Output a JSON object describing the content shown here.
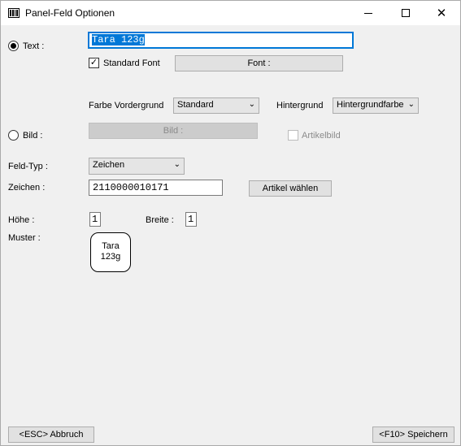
{
  "window": {
    "title": "Panel-Feld Optionen",
    "close_glyph": "✕"
  },
  "text_option": {
    "radio_label": "Text :",
    "selected": true,
    "value": "Tara 123g",
    "standard_font_label": "Standard Font",
    "standard_font_checked": true,
    "font_button": "Font :"
  },
  "colors": {
    "foreground_label": "Farbe Vordergrund",
    "foreground_value": "Standard",
    "background_label": "Hintergrund",
    "background_value": "Hintergrundfarbe"
  },
  "image_option": {
    "radio_label": "Bild :",
    "selected": false,
    "image_button": "Bild :",
    "article_image_label": "Artikelbild"
  },
  "field_type": {
    "label": "Feld-Typ :",
    "value": "Zeichen"
  },
  "characters": {
    "label": "Zeichen :",
    "value": "2110000010171",
    "select_article_button": "Artikel wählen"
  },
  "size": {
    "height_label": "Höhe :",
    "height_value": "1",
    "width_label": "Breite :",
    "width_value": "1"
  },
  "pattern": {
    "label": "Muster :",
    "line1": "Tara",
    "line2": "123g"
  },
  "footer": {
    "cancel_button": "<ESC> Abbruch",
    "save_button": "<F10> Speichern"
  },
  "accent_color": "#0078d7"
}
